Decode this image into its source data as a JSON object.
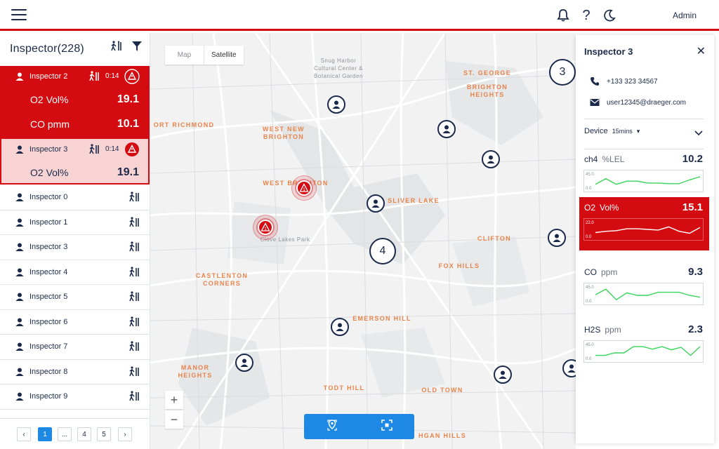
{
  "header": {
    "user": "Admin",
    "icons": [
      "menu-icon",
      "bell-icon",
      "help-icon",
      "moon-icon"
    ]
  },
  "sidebar": {
    "title": "Inspector(228)",
    "active": [
      {
        "name": "Inspector 2",
        "time": "0:14",
        "measurements": [
          {
            "label": "O2  Vol%",
            "value": "19.1"
          },
          {
            "label": "CO  pmm",
            "value": "10.1"
          }
        ]
      },
      {
        "name": "Inspector 3",
        "time": "0:14",
        "measurements": [
          {
            "label": "O2  Vol%",
            "value": "19.1"
          }
        ]
      }
    ],
    "items": [
      {
        "name": "Inspector 0"
      },
      {
        "name": "Inspector 1"
      },
      {
        "name": "Inspector 3"
      },
      {
        "name": "Inspector 4"
      },
      {
        "name": "Inspector 5"
      },
      {
        "name": "Inspector 6"
      },
      {
        "name": "Inspector 7"
      },
      {
        "name": "Inspector 8"
      },
      {
        "name": "Inspector 9"
      }
    ],
    "pagination": {
      "pages": [
        "1",
        "...",
        "4",
        "5"
      ],
      "current": "1"
    }
  },
  "map": {
    "toggle": {
      "map": "Map",
      "satellite": "Satellite"
    },
    "places": [
      "ST. GEORGE",
      "BRIGHTON HEIGHTS",
      "ORT RICHMOND",
      "WEST NEW BRIGHTON",
      "WEST BRIGHTON",
      "SLIVER LAKE",
      "CLIFTON",
      "FOX HILLS",
      "CASTLENTON CORNERS",
      "EMERSON HILL",
      "MANOR HEIGHTS",
      "TODT HILL",
      "OLD TOWN",
      "HGAN HILLS"
    ],
    "pois": [
      "Snug Harbor Cultural Center & Botanical Garden",
      "Clove Lakes Park"
    ],
    "clusters": [
      "3",
      "4"
    ],
    "alarm_count": "1"
  },
  "panel": {
    "title": "Inspector 3",
    "phone": "+133 323 34567",
    "email": "user12345@draeger.com",
    "device_label": "Device",
    "device_interval": "15mins",
    "sensors": [
      {
        "name": "ch4",
        "unit": "%LEL",
        "value": "10.2",
        "alarm": false,
        "ymax": "45.0",
        "ymin": "0.0",
        "series": [
          12,
          30,
          12,
          22,
          22,
          16,
          16,
          14,
          14,
          26,
          36
        ]
      },
      {
        "name": "O2",
        "unit": "Vol%",
        "value": "15.1",
        "alarm": true,
        "ymax": "22.0",
        "ymin": "0.0",
        "series": [
          6,
          8,
          9,
          12,
          12,
          11,
          10,
          15,
          8,
          5,
          14
        ]
      },
      {
        "name": "CO",
        "unit": "ppm",
        "value": "9.3",
        "alarm": false,
        "ymax": "45.0",
        "ymin": "0.0",
        "series": [
          20,
          38,
          4,
          26,
          18,
          18,
          28,
          28,
          28,
          18,
          12
        ]
      },
      {
        "name": "H2S",
        "unit": "ppm",
        "value": "2.3",
        "alarm": false,
        "ymax": "45.0",
        "ymin": "0.0",
        "series": [
          10,
          10,
          18,
          18,
          38,
          38,
          30,
          38,
          28,
          36,
          10,
          38
        ]
      }
    ]
  }
}
